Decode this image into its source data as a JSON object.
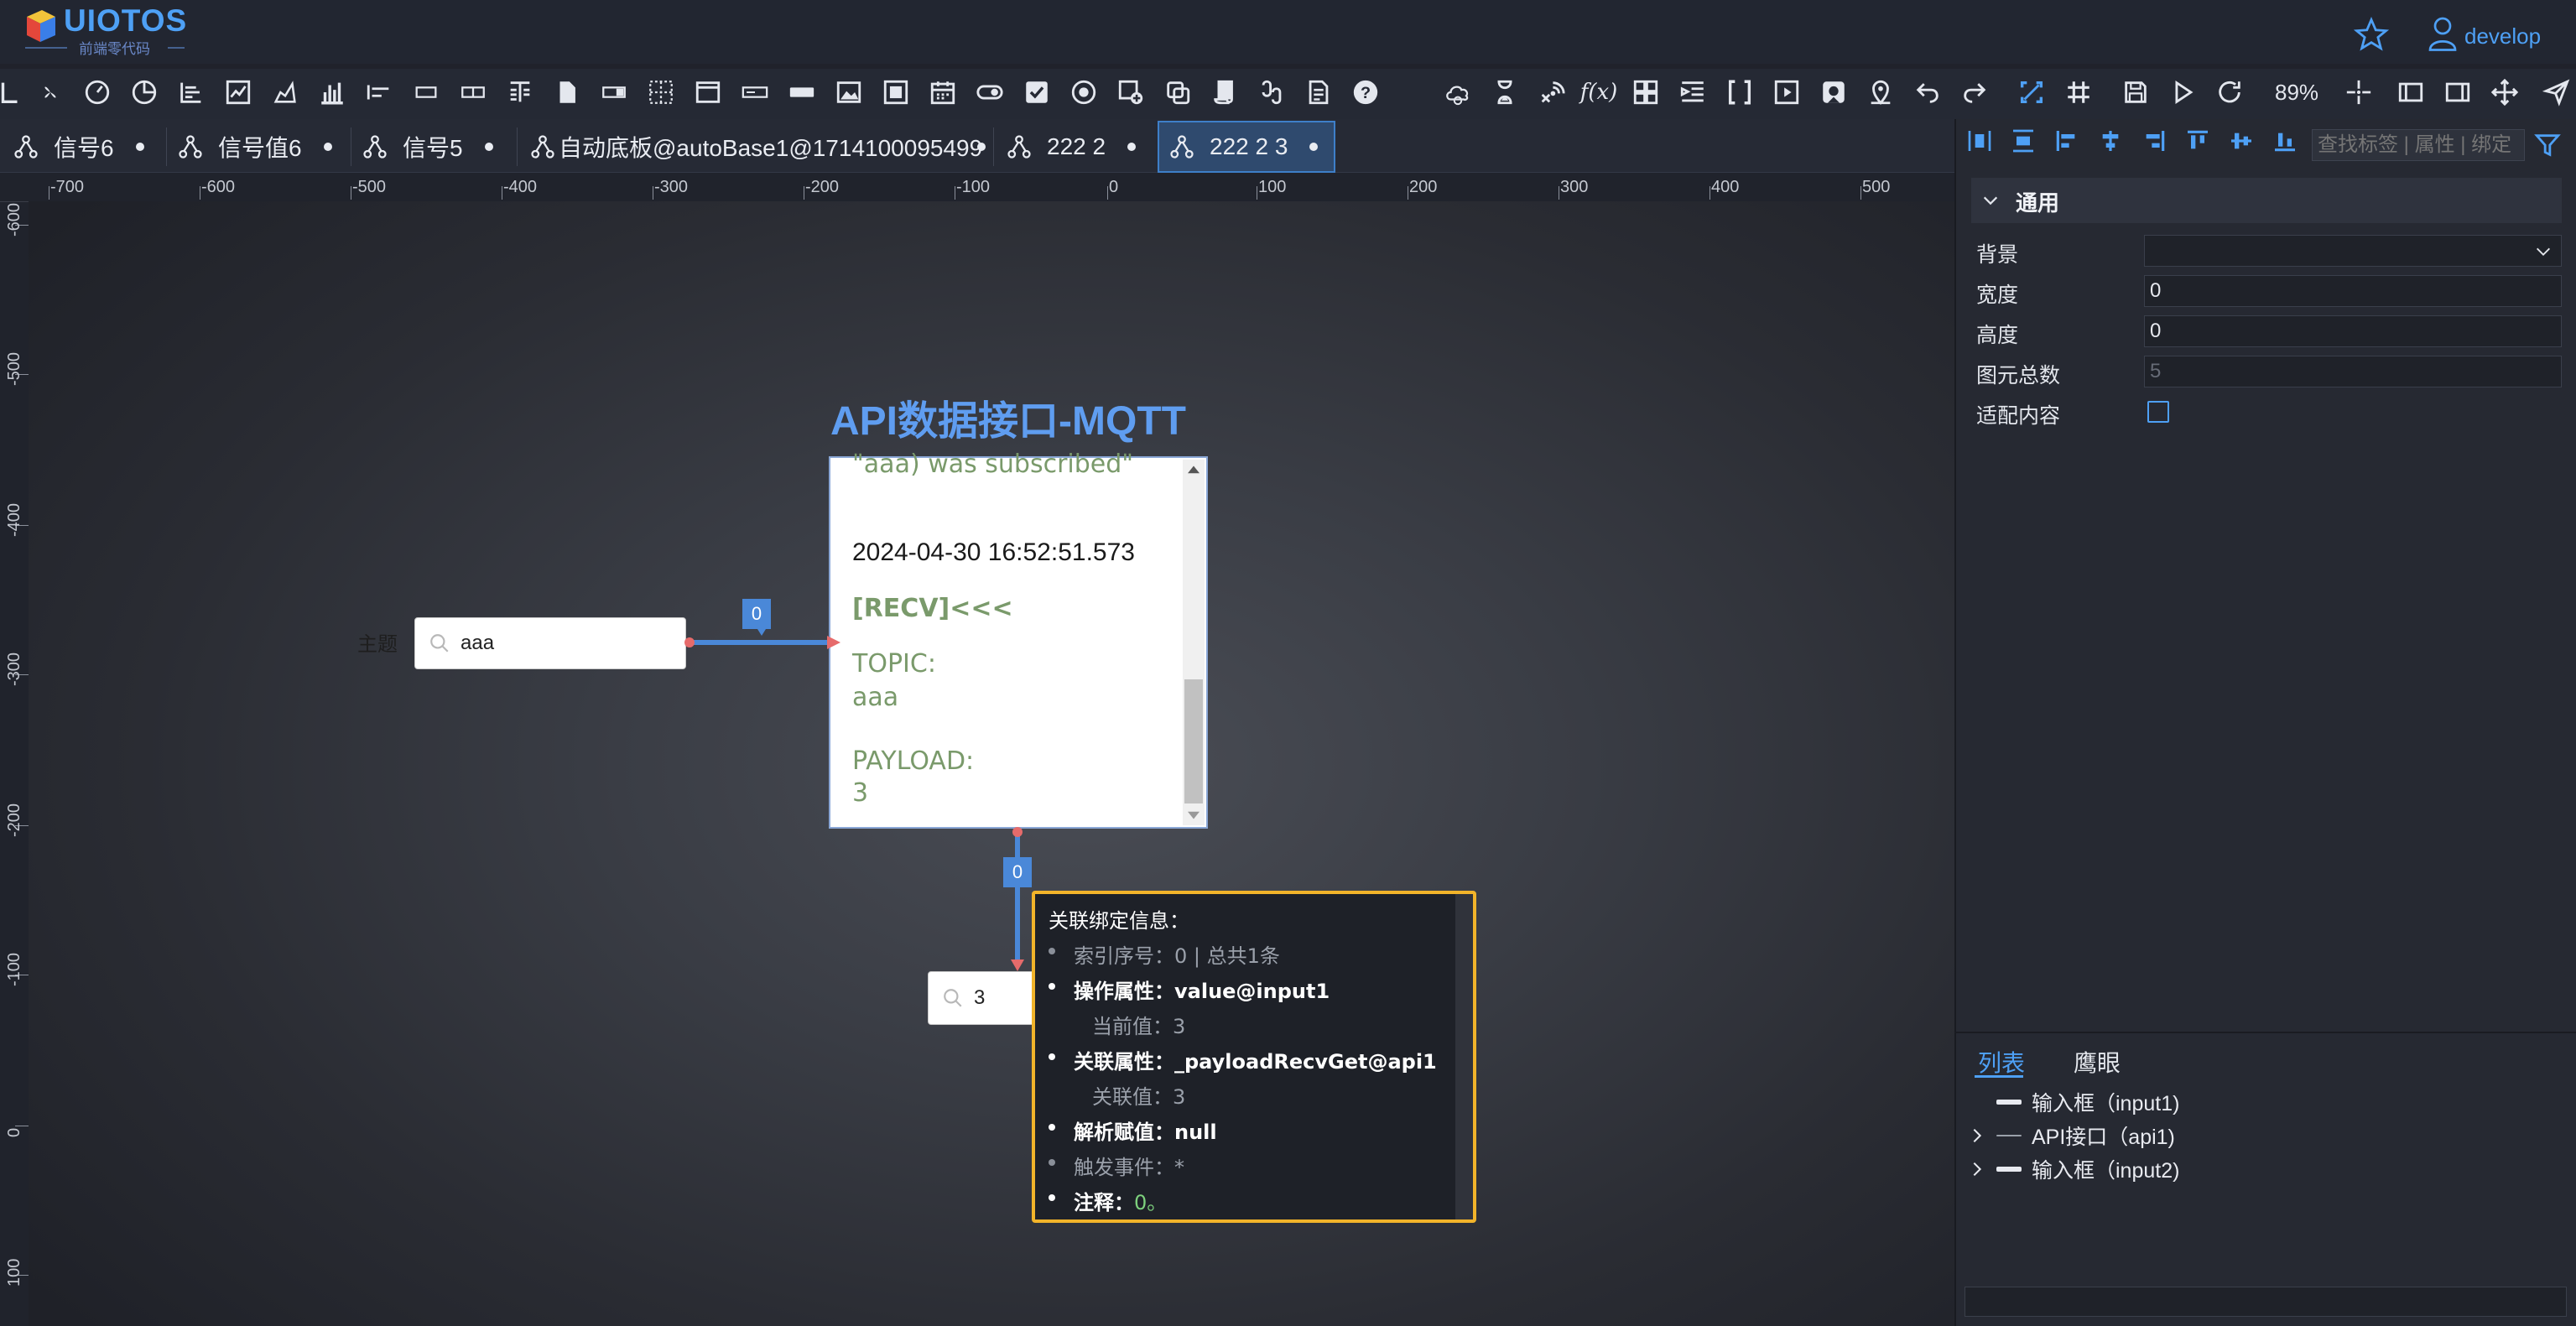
{
  "header": {
    "logo_title": "UIOTOS",
    "logo_subtitle": "前端零代码",
    "user_name": "develop"
  },
  "toolbar": {
    "zoom": "89%"
  },
  "tabs": [
    {
      "label": "信号6"
    },
    {
      "label": "信号值6"
    },
    {
      "label": "信号5"
    },
    {
      "label": "自动底板@autoBase1@1714100095499"
    },
    {
      "label": "222 2"
    },
    {
      "label": "222 2 3",
      "active": true
    }
  ],
  "ruler": {
    "top": [
      "-700",
      "-600",
      "-500",
      "-400",
      "-300",
      "-200",
      "-100",
      "0",
      "100",
      "200",
      "300",
      "400",
      "500"
    ],
    "left": [
      "-600",
      "-500",
      "-400",
      "-300",
      "-200",
      "-100",
      "0",
      "100"
    ]
  },
  "canvas": {
    "api_title": "API数据接口-MQTT",
    "log": {
      "subscribed": "\"aaa) was subscribed\"",
      "timestamp": "2024-04-30 16:52:51.573",
      "recv": "[RECV]<<<",
      "topic_label": "TOPIC:",
      "topic_value": "aaa",
      "payload_label": "PAYLOAD:",
      "payload_value": "3"
    },
    "topic_label": "主题",
    "topic_input_value": "aaa",
    "output_input_value": "3",
    "link_badge_1": "0",
    "link_badge_2": "0"
  },
  "tooltip": {
    "title": "关联绑定信息：",
    "index_line": "索引序号：0 | 总共1条",
    "op_prop_label": "操作属性：",
    "op_prop_value": "value@input1",
    "current_value": "当前值：3",
    "assoc_prop_label": "关联属性：",
    "assoc_prop_value": "_payloadRecvGet@api1",
    "assoc_value": "关联值：3",
    "parse_label": "解析赋值：",
    "parse_value": "null",
    "trigger_line": "触发事件：*",
    "note_label": "注释：",
    "note_value": "0。"
  },
  "panel": {
    "search_placeholder": "查找标签 | 属性 | 绑定",
    "section_title": "通用",
    "props": {
      "background_label": "背景",
      "width_label": "宽度",
      "width_value": "0",
      "height_label": "高度",
      "height_value": "0",
      "count_label": "图元总数",
      "count_value": "5",
      "fit_label": "适配内容"
    },
    "bottom_tabs": {
      "list": "列表",
      "eagle": "鹰眼"
    },
    "tree": [
      {
        "label": "输入框（input1)"
      },
      {
        "label": "API接口（api1)"
      },
      {
        "label": "输入框（input2)"
      }
    ]
  },
  "colors": {
    "accent": "#4ea0f5",
    "tooltip_border": "#f2b42a",
    "link": "#4a88d8",
    "log_green": "#7a9a6b"
  }
}
